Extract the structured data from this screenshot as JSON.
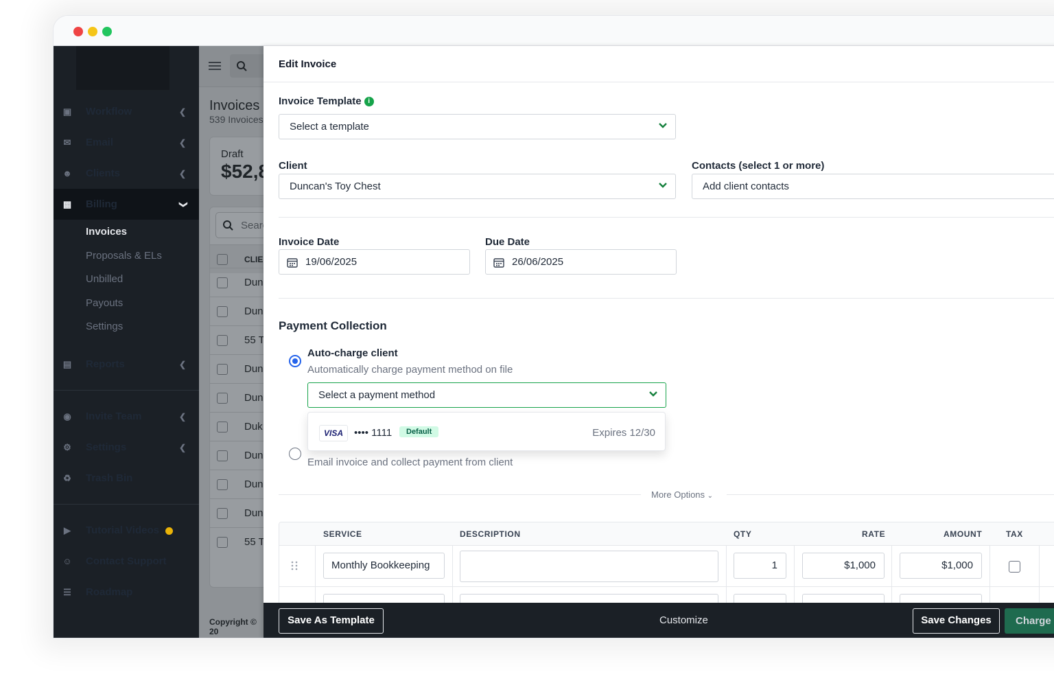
{
  "sidebar": {
    "items": [
      {
        "label": "Workflow",
        "icon": "briefcase-icon"
      },
      {
        "label": "Email",
        "icon": "mail-icon"
      },
      {
        "label": "Clients",
        "icon": "users-icon"
      },
      {
        "label": "Billing",
        "icon": "money-icon"
      },
      {
        "label": "Reports",
        "icon": "document-icon"
      },
      {
        "label": "Invite Team",
        "icon": "team-icon"
      },
      {
        "label": "Settings",
        "icon": "gear-icon"
      },
      {
        "label": "Trash Bin",
        "icon": "trash-icon"
      },
      {
        "label": "Tutorial Videos",
        "icon": "video-icon"
      },
      {
        "label": "Contact Support",
        "icon": "person-icon"
      },
      {
        "label": "Roadmap",
        "icon": "roadmap-icon"
      }
    ],
    "billing_sub": [
      "Invoices",
      "Proposals & ELs",
      "Unbilled",
      "Payouts",
      "Settings"
    ]
  },
  "background": {
    "title": "Invoices",
    "subtitle": "539 Invoices",
    "card_label": "Draft",
    "card_value": "$52,8",
    "search_placeholder": "Search",
    "column_header": "CLIE",
    "rows": [
      "Dun",
      "Dun",
      "55 T",
      "Dun",
      "Dun",
      "Duk",
      "Dun",
      "Dun",
      "Dun",
      "55 T"
    ],
    "copyright": "Copyright © 20"
  },
  "modal": {
    "title": "Edit Invoice",
    "template_label": "Invoice Template",
    "template_value": "Select a template",
    "client_label": "Client",
    "client_value": "Duncan's Toy Chest",
    "contacts_label": "Contacts (select 1 or more)",
    "contacts_placeholder": "Add client contacts",
    "invoice_date_label": "Invoice Date",
    "invoice_date": "19/06/2025",
    "due_date_label": "Due Date",
    "due_date": "26/06/2025",
    "payment_heading": "Payment Collection",
    "auto_charge_title": "Auto-charge client",
    "auto_charge_desc": "Automatically charge payment method on file",
    "payment_method_value": "Select a payment method",
    "card": {
      "brand": "VISA",
      "number": "•••• 1111",
      "badge": "Default",
      "expires": "Expires 12/30"
    },
    "email_option_desc": "Email invoice and collect payment from client",
    "more_options": "More Options",
    "table": {
      "headers": [
        "SERVICE",
        "DESCRIPTION",
        "QTY",
        "RATE",
        "AMOUNT",
        "TAX"
      ],
      "rows": [
        {
          "service": "Monthly Bookkeeping",
          "description": "",
          "qty": "1",
          "rate": "$1,000",
          "amount": "$1,000"
        }
      ]
    },
    "footer": {
      "save_template": "Save As Template",
      "customize": "Customize",
      "save_changes": "Save Changes",
      "charge": "Charge C"
    }
  },
  "colors": {
    "accent": "#16a34a",
    "radio": "#2563eb",
    "sidebar": "#1b2026",
    "charge_button": "#1f6b4f"
  }
}
